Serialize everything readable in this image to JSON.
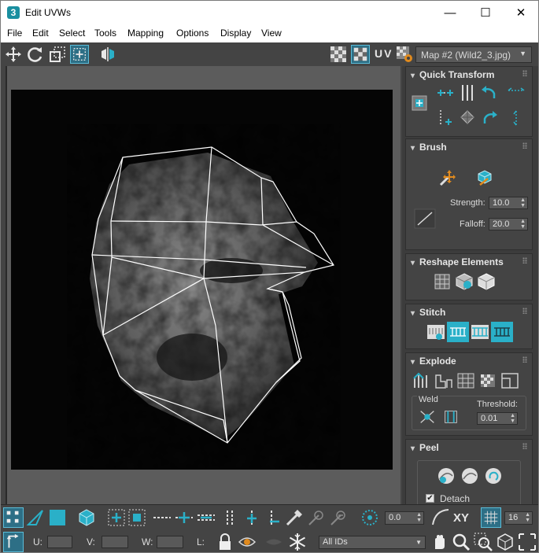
{
  "window": {
    "title": "Edit UVWs",
    "app_icon_glyph": "3",
    "minimize_glyph": "—",
    "maximize_glyph": "☐",
    "close_glyph": "✕"
  },
  "menubar": [
    "File",
    "Edit",
    "Select",
    "Tools",
    "Mapping",
    "Options",
    "Display",
    "View"
  ],
  "toolbar": {
    "uv_label": "UV",
    "map_selector": "Map #2 (Wild2_3.jpg)"
  },
  "panel": {
    "quick_transform": {
      "title": "Quick Transform"
    },
    "brush": {
      "title": "Brush",
      "strength_label": "Strength:",
      "strength_value": "10.0",
      "falloff_label": "Falloff:",
      "falloff_value": "20.0"
    },
    "reshape": {
      "title": "Reshape Elements"
    },
    "stitch": {
      "title": "Stitch"
    },
    "explode": {
      "title": "Explode",
      "weld_label": "Weld",
      "threshold_label": "Threshold:",
      "threshold_value": "0.01"
    },
    "peel": {
      "title": "Peel",
      "detach_label": "Detach",
      "detach_checked": true
    }
  },
  "bottom": {
    "angle_value": "0.0",
    "xy_label": "XY",
    "grid_value": "16",
    "u_label": "U:",
    "v_label": "V:",
    "w_label": "W:",
    "l_label": "L:",
    "ids_dropdown": "All IDs"
  },
  "colors": {
    "accent_teal": "#2ab0c8",
    "ui_dark": "#444444",
    "wire": "#ffffff"
  }
}
